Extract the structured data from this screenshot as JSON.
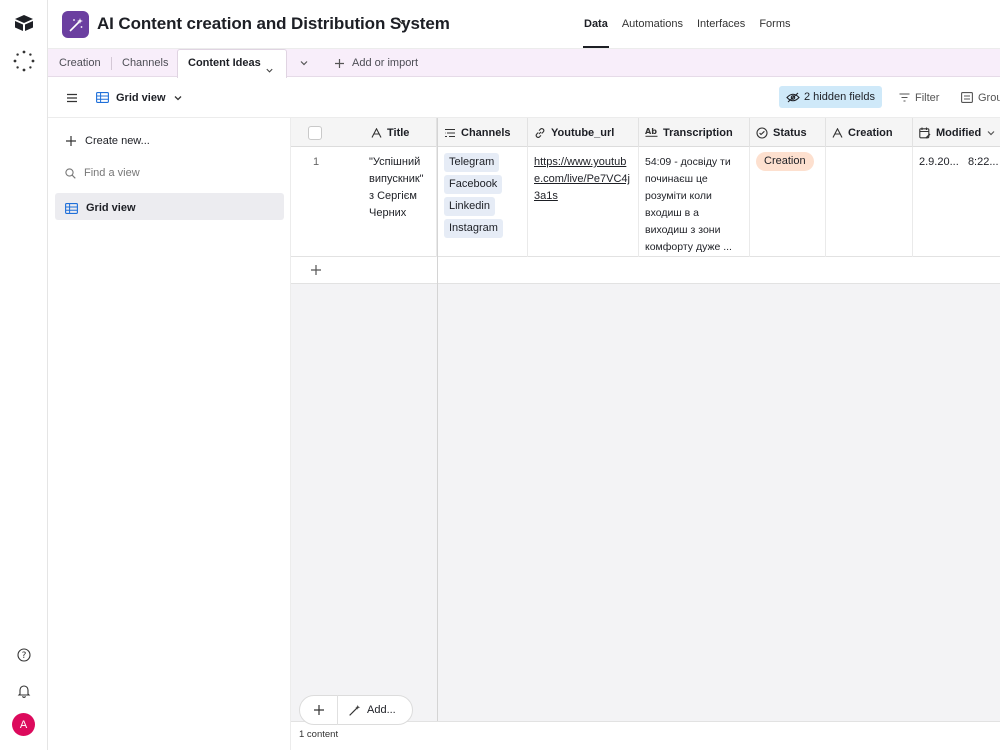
{
  "base": {
    "title": "AI Content creation and Distribution System"
  },
  "topnav": [
    "Data",
    "Automations",
    "Interfaces",
    "Forms"
  ],
  "tabs": {
    "items": [
      "Creation",
      "Channels"
    ],
    "active": "Content Ideas",
    "add_label": "Add or import"
  },
  "toolbar": {
    "view_label": "Grid view",
    "hidden_fields": "2 hidden fields",
    "filter": "Filter",
    "group": "Group"
  },
  "sidebar": {
    "create_new": "Create new...",
    "find_placeholder": "Find a view",
    "view_item": "Grid view"
  },
  "columns": [
    {
      "label": "Title",
      "icon": "text-icon"
    },
    {
      "label": "Channels",
      "icon": "multiselect-icon"
    },
    {
      "label": "Youtube_url",
      "icon": "link-icon"
    },
    {
      "label": "Transcription",
      "icon": "longtext-icon"
    },
    {
      "label": "Status",
      "icon": "status-icon"
    },
    {
      "label": "Creation",
      "icon": "text-icon"
    },
    {
      "label": "Modified",
      "icon": "calendar-edit-icon"
    }
  ],
  "rows": [
    {
      "num": "1",
      "title": "\"Успішний випускник\" з Сергієм Черних",
      "channels": [
        "Telegram",
        "Facebook",
        "Linkedin",
        "Instagram"
      ],
      "youtube_url": "https://www.youtube.com/live/Pe7VC4j3a1s",
      "transcription": "54:09 - досвіду ти починаєш це розуміти коли входиш в а виходиш з зони комфорту дуже ...",
      "status": "Creation",
      "creation": "",
      "modified_date": "2.9.20...",
      "modified_time": "8:22..."
    }
  ],
  "footer": {
    "add_label": "Add...",
    "record_count": "1 content"
  },
  "user": {
    "initial": "A",
    "avatar_color": "#dc0a5c"
  },
  "colors": {
    "base_icon": "#6b3fa0",
    "tabs_bg": "#f8eefa",
    "hidden_fields_bg": "#cfe9f9",
    "status_pill": "#fde0cf",
    "channel_pill": "#e6ecf6"
  }
}
